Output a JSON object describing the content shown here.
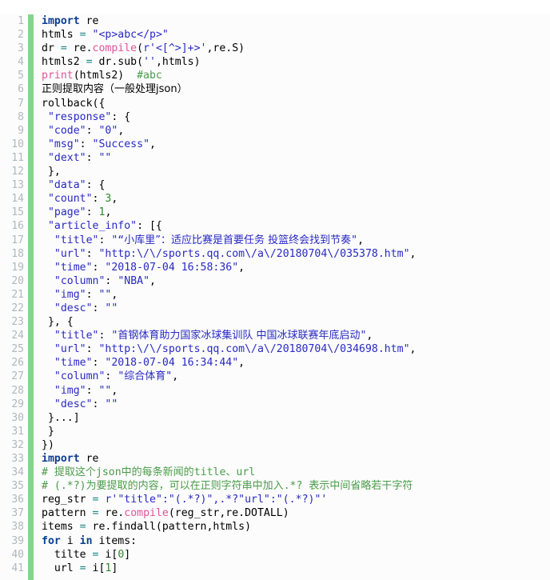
{
  "editor": {
    "name": "code-editor",
    "language": "python",
    "background_color": "#fcfcfc",
    "gutter_color": "#b0b8bd",
    "gutter_bar_color": "#86d48b",
    "first_line": 1,
    "last_line": 41,
    "total_lines": 41,
    "colors": {
      "keyword": "#0b3d91",
      "function": "#e0539c",
      "string": "#2929c4",
      "number": "#2a8a2a",
      "comment": "#4a9c4a",
      "operator": "#1b8585",
      "plain": "#000000"
    }
  },
  "line_numbers": [
    1,
    2,
    3,
    4,
    5,
    6,
    7,
    8,
    9,
    10,
    11,
    12,
    13,
    14,
    15,
    16,
    17,
    18,
    19,
    20,
    21,
    22,
    23,
    24,
    25,
    26,
    27,
    28,
    29,
    30,
    31,
    32,
    33,
    34,
    35,
    36,
    37,
    38,
    39,
    40,
    41
  ],
  "lines": [
    {
      "n": 1,
      "text": "import re"
    },
    {
      "n": 2,
      "text": "htmls = \"<p>abc</p>\""
    },
    {
      "n": 3,
      "text": "dr = re.compile(r'<[^>]+>',re.S)"
    },
    {
      "n": 4,
      "text": "htmls2 = dr.sub('',htmls)"
    },
    {
      "n": 5,
      "text": "print(htmls2)  #abc"
    },
    {
      "n": 6,
      "text": "正则提取内容（一般处理json）"
    },
    {
      "n": 7,
      "text": "rollback({"
    },
    {
      "n": 8,
      "text": " \"response\": {"
    },
    {
      "n": 9,
      "text": " \"code\": \"0\","
    },
    {
      "n": 10,
      "text": " \"msg\": \"Success\","
    },
    {
      "n": 11,
      "text": " \"dext\": \"\""
    },
    {
      "n": 12,
      "text": " },"
    },
    {
      "n": 13,
      "text": " \"data\": {"
    },
    {
      "n": 14,
      "text": " \"count\": 3,"
    },
    {
      "n": 15,
      "text": " \"page\": 1,"
    },
    {
      "n": 16,
      "text": " \"article_info\": [{"
    },
    {
      "n": 17,
      "text": "  \"title\": \"“小库里”：适应比赛是首要任务 投篮终会找到节奏\","
    },
    {
      "n": 18,
      "text": "  \"url\": \"http:\\/\\/sports.qq.com\\/a\\/20180704\\/035378.htm\","
    },
    {
      "n": 19,
      "text": "  \"time\": \"2018-07-04 16:58:36\","
    },
    {
      "n": 20,
      "text": "  \"column\": \"NBA\","
    },
    {
      "n": 21,
      "text": "  \"img\": \"\","
    },
    {
      "n": 22,
      "text": "  \"desc\": \"\""
    },
    {
      "n": 23,
      "text": " }, {"
    },
    {
      "n": 24,
      "text": "  \"title\": \"首钢体育助力国家冰球集训队 中国冰球联赛年底启动\","
    },
    {
      "n": 25,
      "text": "  \"url\": \"http:\\/\\/sports.qq.com\\/a\\/20180704\\/034698.htm\","
    },
    {
      "n": 26,
      "text": "  \"time\": \"2018-07-04 16:34:44\","
    },
    {
      "n": 27,
      "text": "  \"column\": \"综合体育\","
    },
    {
      "n": 28,
      "text": "  \"img\": \"\","
    },
    {
      "n": 29,
      "text": "  \"desc\": \"\""
    },
    {
      "n": 30,
      "text": " }...]"
    },
    {
      "n": 31,
      "text": " }"
    },
    {
      "n": 32,
      "text": "})"
    },
    {
      "n": 33,
      "text": "import re"
    },
    {
      "n": 34,
      "text": "# 提取这个json中的每条新闻的title、url"
    },
    {
      "n": 35,
      "text": "# (.*?)为要提取的内容，可以在正则字符串中加入.*? 表示中间省略若干字符"
    },
    {
      "n": 36,
      "text": "reg_str = r'\"title\":\"(.*?)\",.*?\"url\":\"(.*?)\"'"
    },
    {
      "n": 37,
      "text": "pattern = re.compile(reg_str,re.DOTALL)"
    },
    {
      "n": 38,
      "text": "items = re.findall(pattern,htmls)"
    },
    {
      "n": 39,
      "text": "for i in items:"
    },
    {
      "n": 40,
      "text": "  tilte = i[0]"
    },
    {
      "n": 41,
      "text": "  url = i[1]"
    }
  ],
  "tokens": [
    [
      {
        "t": "import",
        "c": "kw"
      },
      {
        "t": " re",
        "c": "pl"
      }
    ],
    [
      {
        "t": "htmls ",
        "c": "pl"
      },
      {
        "t": "=",
        "c": "op"
      },
      {
        "t": " ",
        "c": "pl"
      },
      {
        "t": "\"<p>abc</p>\"",
        "c": "str"
      }
    ],
    [
      {
        "t": "dr ",
        "c": "pl"
      },
      {
        "t": "=",
        "c": "op"
      },
      {
        "t": " re.",
        "c": "pl"
      },
      {
        "t": "compile",
        "c": "fn"
      },
      {
        "t": "(",
        "c": "pl"
      },
      {
        "t": "r'<[^>]+>'",
        "c": "str"
      },
      {
        "t": ",re.S)",
        "c": "pl"
      }
    ],
    [
      {
        "t": "htmls2 ",
        "c": "pl"
      },
      {
        "t": "=",
        "c": "op"
      },
      {
        "t": " dr.sub(",
        "c": "pl"
      },
      {
        "t": "''",
        "c": "str"
      },
      {
        "t": ",htmls)",
        "c": "pl"
      }
    ],
    [
      {
        "t": "print",
        "c": "fn"
      },
      {
        "t": "(htmls2)  ",
        "c": "pl"
      },
      {
        "t": "#abc",
        "c": "com"
      }
    ],
    [
      {
        "t": "正则提取内容（一般处理json）",
        "c": "pl cjk"
      }
    ],
    [
      {
        "t": "rollback({",
        "c": "pl"
      }
    ],
    [
      {
        "t": " ",
        "c": "pl"
      },
      {
        "t": "\"response\"",
        "c": "str"
      },
      {
        "t": ": {",
        "c": "pl"
      }
    ],
    [
      {
        "t": " ",
        "c": "pl"
      },
      {
        "t": "\"code\"",
        "c": "str"
      },
      {
        "t": ": ",
        "c": "pl"
      },
      {
        "t": "\"0\"",
        "c": "str"
      },
      {
        "t": ",",
        "c": "pl"
      }
    ],
    [
      {
        "t": " ",
        "c": "pl"
      },
      {
        "t": "\"msg\"",
        "c": "str"
      },
      {
        "t": ": ",
        "c": "pl"
      },
      {
        "t": "\"Success\"",
        "c": "str"
      },
      {
        "t": ",",
        "c": "pl"
      }
    ],
    [
      {
        "t": " ",
        "c": "pl"
      },
      {
        "t": "\"dext\"",
        "c": "str"
      },
      {
        "t": ": ",
        "c": "pl"
      },
      {
        "t": "\"\"",
        "c": "str"
      }
    ],
    [
      {
        "t": " },",
        "c": "pl"
      }
    ],
    [
      {
        "t": " ",
        "c": "pl"
      },
      {
        "t": "\"data\"",
        "c": "str"
      },
      {
        "t": ": {",
        "c": "pl"
      }
    ],
    [
      {
        "t": " ",
        "c": "pl"
      },
      {
        "t": "\"count\"",
        "c": "str"
      },
      {
        "t": ": ",
        "c": "pl"
      },
      {
        "t": "3",
        "c": "num"
      },
      {
        "t": ",",
        "c": "pl"
      }
    ],
    [
      {
        "t": " ",
        "c": "pl"
      },
      {
        "t": "\"page\"",
        "c": "str"
      },
      {
        "t": ": ",
        "c": "pl"
      },
      {
        "t": "1",
        "c": "num"
      },
      {
        "t": ",",
        "c": "pl"
      }
    ],
    [
      {
        "t": " ",
        "c": "pl"
      },
      {
        "t": "\"article_info\"",
        "c": "str"
      },
      {
        "t": ": [{",
        "c": "pl"
      }
    ],
    [
      {
        "t": "  ",
        "c": "pl"
      },
      {
        "t": "\"title\"",
        "c": "str"
      },
      {
        "t": ": ",
        "c": "pl"
      },
      {
        "t": "\"“",
        "c": "str"
      },
      {
        "t": "小库里",
        "c": "str cjk"
      },
      {
        "t": "”：",
        "c": "str cjk"
      },
      {
        "t": "适应比赛是首要任务 投篮终会找到节奏",
        "c": "str cjk"
      },
      {
        "t": "\"",
        "c": "str"
      },
      {
        "t": ",",
        "c": "pl"
      }
    ],
    [
      {
        "t": "  ",
        "c": "pl"
      },
      {
        "t": "\"url\"",
        "c": "str"
      },
      {
        "t": ": ",
        "c": "pl"
      },
      {
        "t": "\"http:\\/\\/sports.qq.com\\/a\\/20180704\\/035378.htm\"",
        "c": "str"
      },
      {
        "t": ",",
        "c": "pl"
      }
    ],
    [
      {
        "t": "  ",
        "c": "pl"
      },
      {
        "t": "\"time\"",
        "c": "str"
      },
      {
        "t": ": ",
        "c": "pl"
      },
      {
        "t": "\"2018-07-04 16:58:36\"",
        "c": "str"
      },
      {
        "t": ",",
        "c": "pl"
      }
    ],
    [
      {
        "t": "  ",
        "c": "pl"
      },
      {
        "t": "\"column\"",
        "c": "str"
      },
      {
        "t": ": ",
        "c": "pl"
      },
      {
        "t": "\"NBA\"",
        "c": "str"
      },
      {
        "t": ",",
        "c": "pl"
      }
    ],
    [
      {
        "t": "  ",
        "c": "pl"
      },
      {
        "t": "\"img\"",
        "c": "str"
      },
      {
        "t": ": ",
        "c": "pl"
      },
      {
        "t": "\"\"",
        "c": "str"
      },
      {
        "t": ",",
        "c": "pl"
      }
    ],
    [
      {
        "t": "  ",
        "c": "pl"
      },
      {
        "t": "\"desc\"",
        "c": "str"
      },
      {
        "t": ": ",
        "c": "pl"
      },
      {
        "t": "\"\"",
        "c": "str"
      }
    ],
    [
      {
        "t": " }, {",
        "c": "pl"
      }
    ],
    [
      {
        "t": "  ",
        "c": "pl"
      },
      {
        "t": "\"title\"",
        "c": "str"
      },
      {
        "t": ": ",
        "c": "pl"
      },
      {
        "t": "\"",
        "c": "str"
      },
      {
        "t": "首钢体育助力国家冰球集训队 中国冰球联赛年底启动",
        "c": "str cjk"
      },
      {
        "t": "\"",
        "c": "str"
      },
      {
        "t": ",",
        "c": "pl"
      }
    ],
    [
      {
        "t": "  ",
        "c": "pl"
      },
      {
        "t": "\"url\"",
        "c": "str"
      },
      {
        "t": ": ",
        "c": "pl"
      },
      {
        "t": "\"http:\\/\\/sports.qq.com\\/a\\/20180704\\/034698.htm\"",
        "c": "str"
      },
      {
        "t": ",",
        "c": "pl"
      }
    ],
    [
      {
        "t": "  ",
        "c": "pl"
      },
      {
        "t": "\"time\"",
        "c": "str"
      },
      {
        "t": ": ",
        "c": "pl"
      },
      {
        "t": "\"2018-07-04 16:34:44\"",
        "c": "str"
      },
      {
        "t": ",",
        "c": "pl"
      }
    ],
    [
      {
        "t": "  ",
        "c": "pl"
      },
      {
        "t": "\"column\"",
        "c": "str"
      },
      {
        "t": ": ",
        "c": "pl"
      },
      {
        "t": "\"",
        "c": "str"
      },
      {
        "t": "综合体育",
        "c": "str cjk"
      },
      {
        "t": "\"",
        "c": "str"
      },
      {
        "t": ",",
        "c": "pl"
      }
    ],
    [
      {
        "t": "  ",
        "c": "pl"
      },
      {
        "t": "\"img\"",
        "c": "str"
      },
      {
        "t": ": ",
        "c": "pl"
      },
      {
        "t": "\"\"",
        "c": "str"
      },
      {
        "t": ",",
        "c": "pl"
      }
    ],
    [
      {
        "t": "  ",
        "c": "pl"
      },
      {
        "t": "\"desc\"",
        "c": "str"
      },
      {
        "t": ": ",
        "c": "pl"
      },
      {
        "t": "\"\"",
        "c": "str"
      }
    ],
    [
      {
        "t": " }...]",
        "c": "pl"
      }
    ],
    [
      {
        "t": " }",
        "c": "pl"
      }
    ],
    [
      {
        "t": "})",
        "c": "pl"
      }
    ],
    [
      {
        "t": "import",
        "c": "kw"
      },
      {
        "t": " re",
        "c": "pl"
      }
    ],
    [
      {
        "t": "# ",
        "c": "com"
      },
      {
        "t": "提取这个",
        "c": "com cjk"
      },
      {
        "t": "json",
        "c": "com"
      },
      {
        "t": "中的每条新闻的",
        "c": "com cjk"
      },
      {
        "t": "title",
        "c": "com"
      },
      {
        "t": "、",
        "c": "com cjk"
      },
      {
        "t": "url",
        "c": "com"
      }
    ],
    [
      {
        "t": "# (.*?)",
        "c": "com"
      },
      {
        "t": "为要提取的内容，可以在正则字符串中加入",
        "c": "com cjk"
      },
      {
        "t": ".*? ",
        "c": "com"
      },
      {
        "t": "表示中间省略若干字符",
        "c": "com cjk"
      }
    ],
    [
      {
        "t": "reg_str ",
        "c": "pl"
      },
      {
        "t": "=",
        "c": "op"
      },
      {
        "t": " ",
        "c": "pl"
      },
      {
        "t": "r'\"title\":\"(.*?)\",.*?\"url\":\"(.*?)\"'",
        "c": "str"
      }
    ],
    [
      {
        "t": "pattern ",
        "c": "pl"
      },
      {
        "t": "=",
        "c": "op"
      },
      {
        "t": " re.",
        "c": "pl"
      },
      {
        "t": "compile",
        "c": "fn"
      },
      {
        "t": "(reg_str,re.DOTALL)",
        "c": "pl"
      }
    ],
    [
      {
        "t": "items ",
        "c": "pl"
      },
      {
        "t": "=",
        "c": "op"
      },
      {
        "t": " re.findall(pattern,htmls)",
        "c": "pl"
      }
    ],
    [
      {
        "t": "for",
        "c": "kw"
      },
      {
        "t": " i ",
        "c": "pl"
      },
      {
        "t": "in",
        "c": "kw"
      },
      {
        "t": " items:",
        "c": "pl"
      }
    ],
    [
      {
        "t": "  tilte ",
        "c": "pl"
      },
      {
        "t": "=",
        "c": "op"
      },
      {
        "t": " i[",
        "c": "pl"
      },
      {
        "t": "0",
        "c": "num"
      },
      {
        "t": "]",
        "c": "pl"
      }
    ],
    [
      {
        "t": "  url ",
        "c": "pl"
      },
      {
        "t": "=",
        "c": "op"
      },
      {
        "t": " i[",
        "c": "pl"
      },
      {
        "t": "1",
        "c": "num"
      },
      {
        "t": "]",
        "c": "pl"
      }
    ]
  ]
}
